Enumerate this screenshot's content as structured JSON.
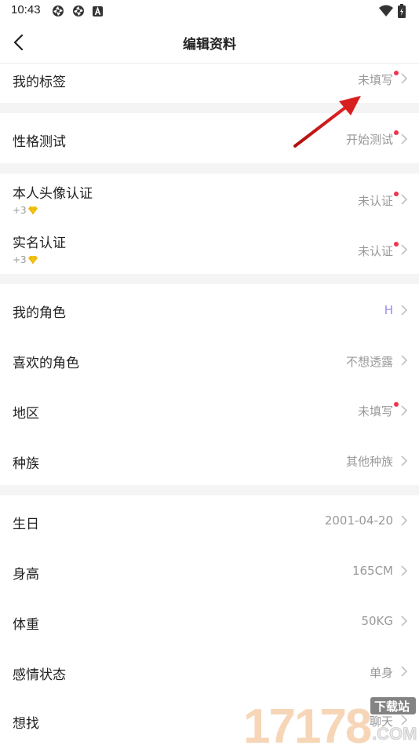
{
  "status_bar": {
    "time": "10:43",
    "icons": [
      "aperture-icon",
      "aperture-icon",
      "a-badge-icon",
      "wifi-icon",
      "battery-icon"
    ]
  },
  "header": {
    "back_icon": "chevron-left-icon",
    "title": "编辑资料"
  },
  "sections": {
    "tags": {
      "label": "我的标签",
      "value": "未填写",
      "has_dot": true
    },
    "personality": {
      "label": "性格测试",
      "value": "开始测试",
      "has_dot": true
    },
    "avatar_verify": {
      "label": "本人头像认证",
      "reward": "+3",
      "value": "未认证",
      "has_dot": true
    },
    "realname_verify": {
      "label": "实名认证",
      "reward": "+3",
      "value": "未认证",
      "has_dot": true
    },
    "my_role": {
      "label": "我的角色",
      "value": "H"
    },
    "fav_role": {
      "label": "喜欢的角色",
      "value": "不想透露"
    },
    "region": {
      "label": "地区",
      "value": "未填写",
      "has_dot": true
    },
    "race": {
      "label": "种族",
      "value": "其他种族"
    },
    "birthday": {
      "label": "生日",
      "value": "2001-04-20"
    },
    "height": {
      "label": "身高",
      "value": "165CM"
    },
    "weight": {
      "label": "体重",
      "value": "50KG"
    },
    "relationship": {
      "label": "感情状态",
      "value": "单身"
    },
    "looking_for": {
      "label": "想找",
      "value": "聊天"
    }
  },
  "colors": {
    "red_dot": "#f0344d",
    "purple_value": "#9b8cf0",
    "annotation_arrow": "#d81e1e",
    "separator": "#f4f4f4"
  },
  "watermark": {
    "number": "17178",
    "badge": "下载站",
    "domain": ".COM"
  }
}
